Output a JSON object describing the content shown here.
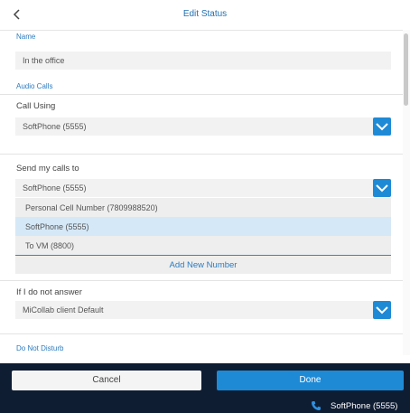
{
  "header": {
    "title": "Edit Status"
  },
  "name_section": {
    "label": "Name",
    "value": "In the office"
  },
  "audio_section": {
    "label": "Audio Calls"
  },
  "call_using": {
    "label": "Call Using",
    "value": "SoftPhone (5555)"
  },
  "send_calls": {
    "label": "Send my calls to",
    "value": "SoftPhone (5555)",
    "options": [
      "Personal Cell Number (7809988520)",
      "SoftPhone (5555)",
      "To VM (8800)"
    ],
    "selected_option": "SoftPhone (5555)",
    "add_new_label": "Add New Number"
  },
  "no_answer": {
    "label": "If I do not answer",
    "value": "MiCollab client Default"
  },
  "dnd_section": {
    "label": "Do Not Disturb"
  },
  "footer": {
    "cancel_label": "Cancel",
    "done_label": "Done"
  },
  "status_bar": {
    "text": "SoftPhone (5555)"
  },
  "colors": {
    "accent": "#1e8ad6",
    "footer_bg": "#0f1d33",
    "selected_bg": "#d5e8f7"
  },
  "icons": [
    "chevron-left-icon",
    "chevron-down-icon",
    "phone-icon"
  ]
}
